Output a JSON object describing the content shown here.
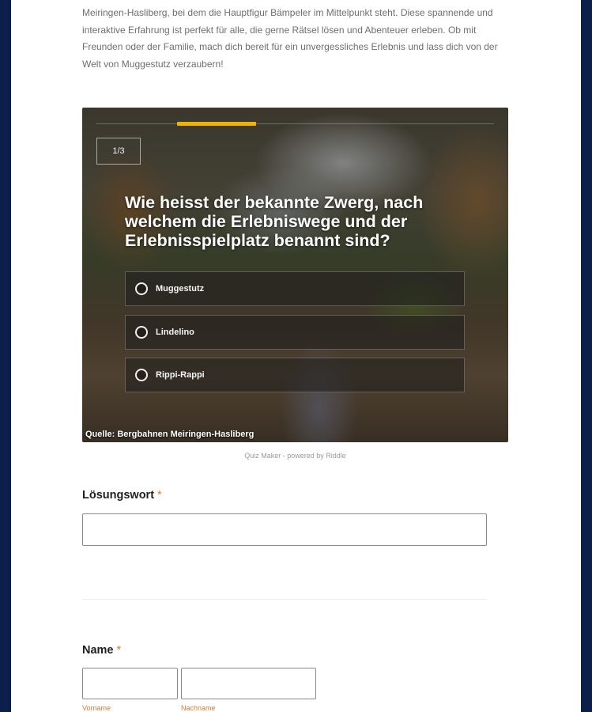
{
  "intro": {
    "text": "Meiringen-Hasliberg, bei dem die Hauptfigur Bämpeler im Mittelpunkt steht. Diese spannende und interaktive Erfahrung ist perfekt für alle, die gerne Rätsel lösen und Abenteuer erleben. Ob mit Freunden oder der Familie,  mach dich bereit für ein unvergessliches Erlebnis und lass dich von der Welt von Muggestutz verzaubern!"
  },
  "quiz": {
    "progress": 0.2,
    "counter": "1/3",
    "question": "Wie heisst der bekannte Zwerg, nach welchem die Erlebniswege und der Erlebnisspielplatz benannt sind?",
    "answers": [
      "Muggestutz",
      "Lindelino",
      "Rippi-Rappi"
    ],
    "credit": "Quelle: Bergbahnen Meiringen-Hasliberg",
    "accent_color": "#f0b400"
  },
  "powered_by": "Quiz Maker - powered by Riddle",
  "form": {
    "solution": {
      "label": "Lösungswort",
      "required_mark": "*",
      "value": ""
    },
    "name": {
      "label": "Name",
      "required_mark": "*",
      "first_label": "Vorname",
      "last_label": "Nachname"
    }
  }
}
